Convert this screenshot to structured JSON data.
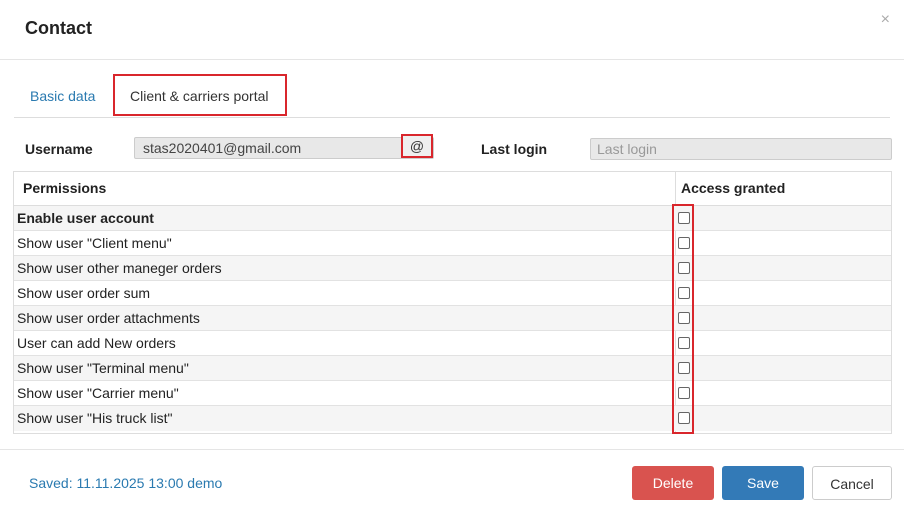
{
  "dialog": {
    "title": "Contact",
    "close_glyph": "×"
  },
  "tabs": [
    {
      "label": "Basic data"
    },
    {
      "label": "Client & carriers portal"
    }
  ],
  "form": {
    "username_label": "Username",
    "username_value": "stas2020401@gmail.com",
    "at_button": "@",
    "last_login_label": "Last login",
    "last_login_placeholder": "Last login"
  },
  "permissions": {
    "col_permissions": "Permissions",
    "col_access": "Access granted",
    "rows": [
      {
        "label": "Enable user account",
        "checked": false
      },
      {
        "label": "Show user \"Client menu\"",
        "checked": false
      },
      {
        "label": "Show user other maneger orders",
        "checked": false
      },
      {
        "label": "Show user order sum",
        "checked": false
      },
      {
        "label": "Show user order attachments",
        "checked": false
      },
      {
        "label": "User can add New orders",
        "checked": false
      },
      {
        "label": "Show user \"Terminal menu\"",
        "checked": false
      },
      {
        "label": "Show user \"Carrier menu\"",
        "checked": false
      },
      {
        "label": "Show user \"His truck list\"",
        "checked": false
      }
    ]
  },
  "footer": {
    "saved_text": "Saved: 11.11.2025 13:00 demo",
    "delete_label": "Delete",
    "save_label": "Save",
    "cancel_label": "Cancel"
  },
  "colors": {
    "accent_blue": "#337ab7",
    "danger_red": "#d9534f",
    "highlight_red": "#d9262c",
    "link_blue": "#2a7ab0"
  }
}
